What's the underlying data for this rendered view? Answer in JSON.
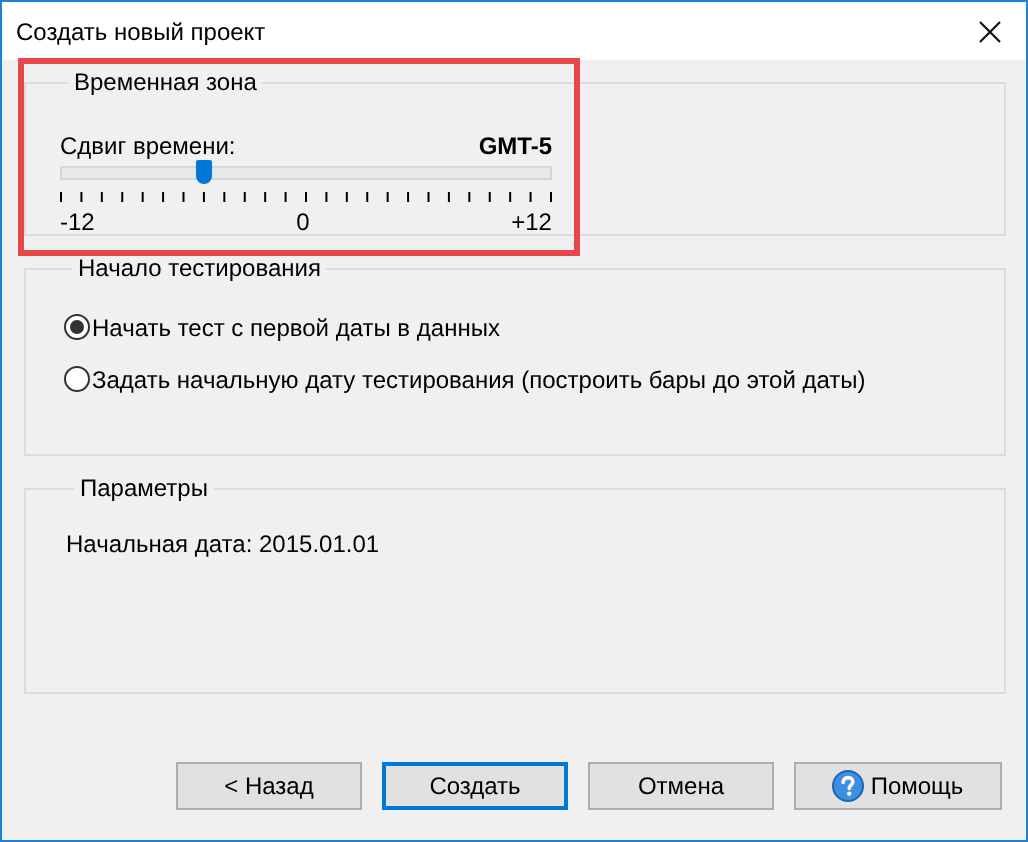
{
  "window": {
    "title": "Создать новый проект"
  },
  "timezone_group": {
    "title": "Временная зона",
    "highlighted": true,
    "label": "Сдвиг времени:",
    "value": "GMT-5",
    "level": 0.2917,
    "scale_labels": [
      "-12",
      "0",
      "+12"
    ]
  },
  "start_group": {
    "title": "Начало тестирования",
    "options": [
      {
        "label": "Начать тест с первой даты в данных",
        "selected": true
      },
      {
        "label": "Задать начальную дату тестирования (построить бары до этой даты)",
        "selected": false
      }
    ]
  },
  "params_group": {
    "title": "Параметры",
    "text": "Начальная дата: 2015.01.01"
  },
  "buttons": [
    {
      "label": "< Назад",
      "kind": "plain",
      "default": false
    },
    {
      "label": "Создать",
      "kind": "plain",
      "default": true
    },
    {
      "label": "Отмена",
      "kind": "plain",
      "default": false
    },
    {
      "label": "Помощь",
      "kind": "help",
      "default": false
    }
  ]
}
